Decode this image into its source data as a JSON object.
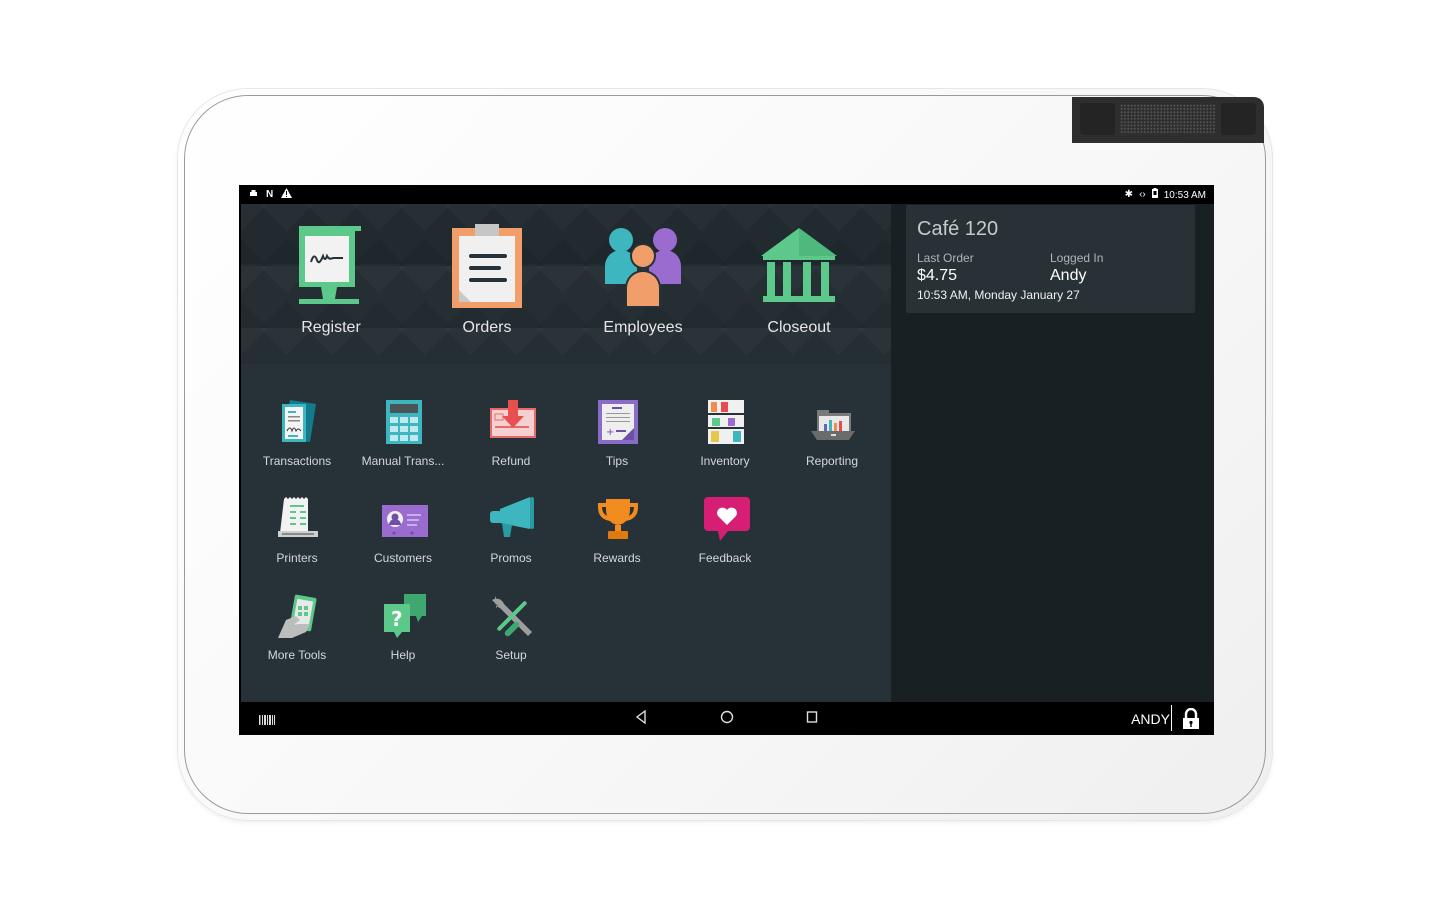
{
  "device": {
    "camera": "front-camera-speaker-bar"
  },
  "status_bar": {
    "left_icons": [
      "printer-icon",
      "nfc-icon",
      "warning-icon"
    ],
    "right_icons": [
      "bluetooth-icon",
      "data-sync-icon",
      "battery-icon"
    ],
    "time": "10:53 AM"
  },
  "hero_apps": [
    {
      "label": "Register",
      "icon": "register-signature-icon"
    },
    {
      "label": "Orders",
      "icon": "clipboard-icon"
    },
    {
      "label": "Employees",
      "icon": "people-icon"
    },
    {
      "label": "Closeout",
      "icon": "bank-icon"
    }
  ],
  "apps": [
    {
      "label": "Transactions",
      "icon": "receipts-icon"
    },
    {
      "label": "Manual Trans...",
      "icon": "calculator-icon"
    },
    {
      "label": "Refund",
      "icon": "refund-card-icon"
    },
    {
      "label": "Tips",
      "icon": "tips-sheet-icon"
    },
    {
      "label": "Inventory",
      "icon": "shelves-icon"
    },
    {
      "label": "Reporting",
      "icon": "report-folder-icon"
    },
    {
      "label": "Printers",
      "icon": "receipt-printer-icon"
    },
    {
      "label": "Customers",
      "icon": "customer-card-icon"
    },
    {
      "label": "Promos",
      "icon": "megaphone-icon"
    },
    {
      "label": "Rewards",
      "icon": "trophy-icon"
    },
    {
      "label": "Feedback",
      "icon": "heart-bubble-icon"
    },
    {
      "label": "More Tools",
      "icon": "hand-device-icon"
    },
    {
      "label": "Help",
      "icon": "help-bubble-icon"
    },
    {
      "label": "Setup",
      "icon": "wrench-screwdriver-icon"
    }
  ],
  "info_card": {
    "merchant_name": "Café 120",
    "last_order_label": "Last Order",
    "last_order_value": "$4.75",
    "logged_in_label": "Logged In",
    "logged_in_value": "Andy",
    "timestamp": "10:53 AM, Monday January 27"
  },
  "nav_bar": {
    "left_icon": "barcode-icon",
    "back": "back-icon",
    "home": "home-icon",
    "recents": "recents-icon",
    "user": "ANDY",
    "lock": "lock-icon"
  },
  "colors": {
    "accent_green": "#5cc98a",
    "orange": "#f29e6a",
    "teal": "#3db6c0",
    "purple": "#9a6cd0",
    "pink": "#d61f74",
    "panel": "#263238",
    "right_panel": "#182023"
  }
}
